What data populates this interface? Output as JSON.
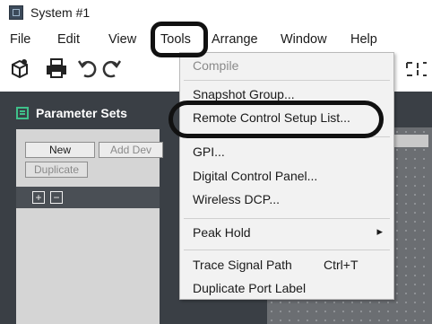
{
  "window": {
    "title": "System #1"
  },
  "menubar": {
    "items": [
      {
        "label": "File"
      },
      {
        "label": "Edit"
      },
      {
        "label": "View"
      },
      {
        "label": "Tools"
      },
      {
        "label": "Arrange"
      },
      {
        "label": "Window"
      },
      {
        "label": "Help"
      }
    ]
  },
  "toolbar": {
    "icons": [
      "box-icon",
      "print-icon",
      "undo-icon",
      "redo-icon"
    ]
  },
  "panel": {
    "title": "Parameter Sets",
    "buttons": {
      "new": "New",
      "add_device": "Add Dev",
      "duplicate": "Duplicate"
    },
    "expand_symbol": "+",
    "collapse_symbol": "−"
  },
  "tools_menu": {
    "items": [
      {
        "label": "Compile",
        "enabled": false
      },
      {
        "label": "Snapshot Group...",
        "enabled": true
      },
      {
        "label": "Remote Control Setup List...",
        "enabled": true
      },
      {
        "label": "GPI...",
        "enabled": true
      },
      {
        "label": "Digital Control Panel...",
        "enabled": true
      },
      {
        "label": "Wireless DCP...",
        "enabled": true
      },
      {
        "label": "Peak Hold",
        "enabled": true,
        "submenu_arrow": "▸"
      },
      {
        "label": "Trace Signal Path",
        "shortcut": "Ctrl+T",
        "enabled": true
      },
      {
        "label": "Duplicate Port Label",
        "enabled": true
      }
    ]
  },
  "colors": {
    "panel_background": "#3a3f45",
    "panel_icon": "#3fc08a",
    "menu_background": "#f2f2f2"
  }
}
